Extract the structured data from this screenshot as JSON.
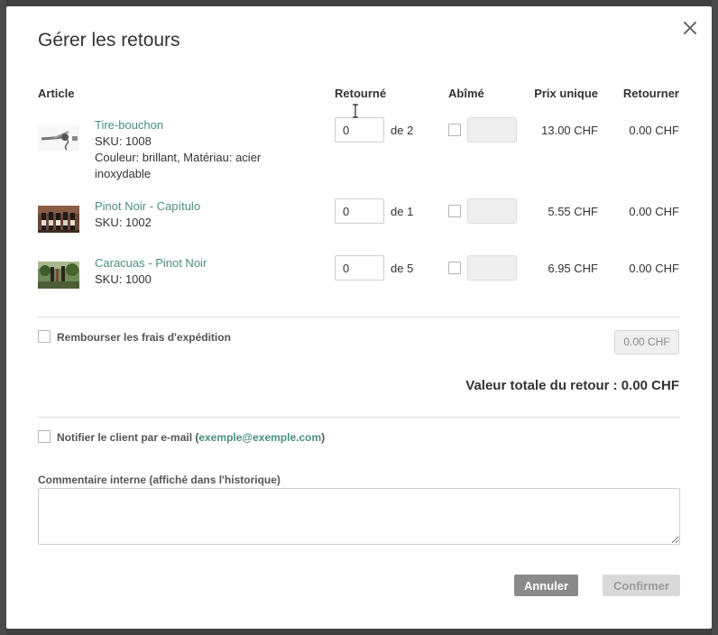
{
  "modal": {
    "title": "Gérer les retours",
    "close_icon": "close-icon"
  },
  "columns": {
    "article": "Article",
    "returned": "Retourné",
    "damaged": "Abîmé",
    "unit_price": "Prix unique",
    "refund": "Retourner"
  },
  "items": [
    {
      "name": "Tire-bouchon",
      "sku": "SKU: 1008",
      "options": [
        "Couleur: brillant, Matériau: acier",
        "inoxydable"
      ],
      "returned_value": "0",
      "of_label": "de 2",
      "damaged_checked": false,
      "unit_price": "13.00 CHF",
      "refund": "0.00 CHF",
      "thumb_icon": "corkscrew-image"
    },
    {
      "name": "Pinot Noir - Capítulo",
      "sku": "SKU: 1002",
      "options": [],
      "returned_value": "0",
      "of_label": "de 1",
      "damaged_checked": false,
      "unit_price": "5.55 CHF",
      "refund": "0.00 CHF",
      "thumb_icon": "wine-bottles-image"
    },
    {
      "name": "Caracuas - Pinot Noir",
      "sku": "SKU: 1000",
      "options": [],
      "returned_value": "0",
      "of_label": "de 5",
      "damaged_checked": false,
      "unit_price": "6.95 CHF",
      "refund": "0.00 CHF",
      "thumb_icon": "vineyard-image"
    }
  ],
  "shipping": {
    "label": "Rembourser les frais d'expédition",
    "value": "0.00 CHF",
    "checked": false
  },
  "total": {
    "label": "Valeur totale du retour : 0.00 CHF"
  },
  "notify": {
    "label_prefix": "Notifier le client par e-mail (",
    "email": "exemple@exemple.com",
    "label_suffix": ")",
    "checked": false
  },
  "comment": {
    "label": "Commentaire interne (affiché dans l'historique)",
    "value": ""
  },
  "buttons": {
    "cancel": "Annuler",
    "confirm": "Confirmer"
  },
  "colors": {
    "accent_green": "#4a8f7f",
    "cancel_bg": "#8a8a8a",
    "confirm_bg": "#d9d9d9",
    "overlay": "#3f3f3f"
  }
}
